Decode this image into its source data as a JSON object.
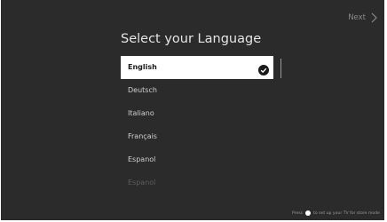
{
  "header": {
    "next_label": "Next",
    "next_icon": "chevron-right-icon"
  },
  "title": "Select your Language",
  "languages": [
    {
      "label": "English",
      "selected": true
    },
    {
      "label": "Deutsch",
      "selected": false
    },
    {
      "label": "Italiano",
      "selected": false
    },
    {
      "label": "Français",
      "selected": false
    },
    {
      "label": "Espanol",
      "selected": false
    },
    {
      "label": "Espanol",
      "selected": false
    }
  ],
  "footer": {
    "text_before": "Press",
    "text_after": "to set up your TV for store mode"
  },
  "colors": {
    "background": "#2b2b2b",
    "selected_bg": "#ffffff",
    "text": "#d0d0d0"
  }
}
